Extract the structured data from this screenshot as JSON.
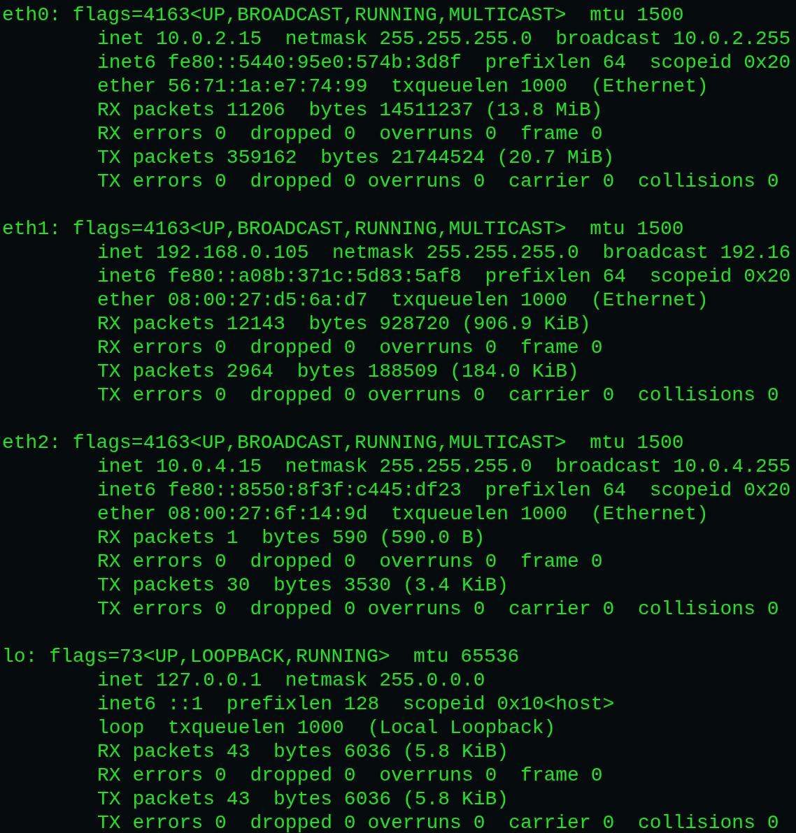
{
  "interfaces": [
    {
      "header": "eth0: flags=4163<UP,BROADCAST,RUNNING,MULTICAST>  mtu 1500",
      "lines": [
        "inet 10.0.2.15  netmask 255.255.255.0  broadcast 10.0.2.255",
        "inet6 fe80::5440:95e0:574b:3d8f  prefixlen 64  scopeid 0x20",
        "ether 56:71:1a:e7:74:99  txqueuelen 1000  (Ethernet)",
        "RX packets 11206  bytes 14511237 (13.8 MiB)",
        "RX errors 0  dropped 0  overruns 0  frame 0",
        "TX packets 359162  bytes 21744524 (20.7 MiB)",
        "TX errors 0  dropped 0 overruns 0  carrier 0  collisions 0"
      ]
    },
    {
      "header": "eth1: flags=4163<UP,BROADCAST,RUNNING,MULTICAST>  mtu 1500",
      "lines": [
        "inet 192.168.0.105  netmask 255.255.255.0  broadcast 192.16",
        "inet6 fe80::a08b:371c:5d83:5af8  prefixlen 64  scopeid 0x20",
        "ether 08:00:27:d5:6a:d7  txqueuelen 1000  (Ethernet)",
        "RX packets 12143  bytes 928720 (906.9 KiB)",
        "RX errors 0  dropped 0  overruns 0  frame 0",
        "TX packets 2964  bytes 188509 (184.0 KiB)",
        "TX errors 0  dropped 0 overruns 0  carrier 0  collisions 0"
      ]
    },
    {
      "header": "eth2: flags=4163<UP,BROADCAST,RUNNING,MULTICAST>  mtu 1500",
      "lines": [
        "inet 10.0.4.15  netmask 255.255.255.0  broadcast 10.0.4.255",
        "inet6 fe80::8550:8f3f:c445:df23  prefixlen 64  scopeid 0x20",
        "ether 08:00:27:6f:14:9d  txqueuelen 1000  (Ethernet)",
        "RX packets 1  bytes 590 (590.0 B)",
        "RX errors 0  dropped 0  overruns 0  frame 0",
        "TX packets 30  bytes 3530 (3.4 KiB)",
        "TX errors 0  dropped 0 overruns 0  carrier 0  collisions 0"
      ]
    },
    {
      "header": "lo: flags=73<UP,LOOPBACK,RUNNING>  mtu 65536",
      "lines": [
        "inet 127.0.0.1  netmask 255.0.0.0",
        "inet6 ::1  prefixlen 128  scopeid 0x10<host>",
        "loop  txqueuelen 1000  (Local Loopback)",
        "RX packets 43  bytes 6036 (5.8 KiB)",
        "RX errors 0  dropped 0  overruns 0  frame 0",
        "TX packets 43  bytes 6036 (5.8 KiB)",
        "TX errors 0  dropped 0 overruns 0  carrier 0  collisions 0"
      ]
    }
  ]
}
